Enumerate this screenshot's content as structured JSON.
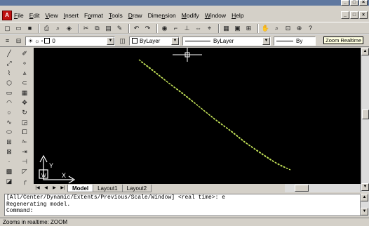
{
  "menu": {
    "items": [
      "File",
      "Edit",
      "View",
      "Insert",
      "Format",
      "Tools",
      "Draw",
      "Dimension",
      "Modify",
      "Window",
      "Help"
    ],
    "hotkeys": [
      "F",
      "E",
      "V",
      "I",
      "o",
      "T",
      "D",
      "n",
      "M",
      "W",
      "H"
    ]
  },
  "window_controls": {
    "minimize": "_",
    "restore": "□",
    "close": "×"
  },
  "layer_toolbar": {
    "layer_value": "0",
    "color_value": "ByLayer",
    "linetype_value": "ByLayer",
    "lineweight_value": "By"
  },
  "tooltip": "Zoom Realtime",
  "layout_tabs": [
    {
      "label": "Model",
      "active": true
    },
    {
      "label": "Layout1",
      "active": false
    },
    {
      "label": "Layout2",
      "active": false
    }
  ],
  "command_window": {
    "lines": [
      "[All/Center/Dynamic/Extents/Previous/Scale/Window] <real time>: e",
      "Regenerating model.",
      "Command:"
    ]
  },
  "status_bar": {
    "text": "Zooms in realtime: ZOOM"
  },
  "colors": {
    "canvas": "#000000",
    "line": "#c8e85a",
    "chrome": "#d4d0c8"
  }
}
